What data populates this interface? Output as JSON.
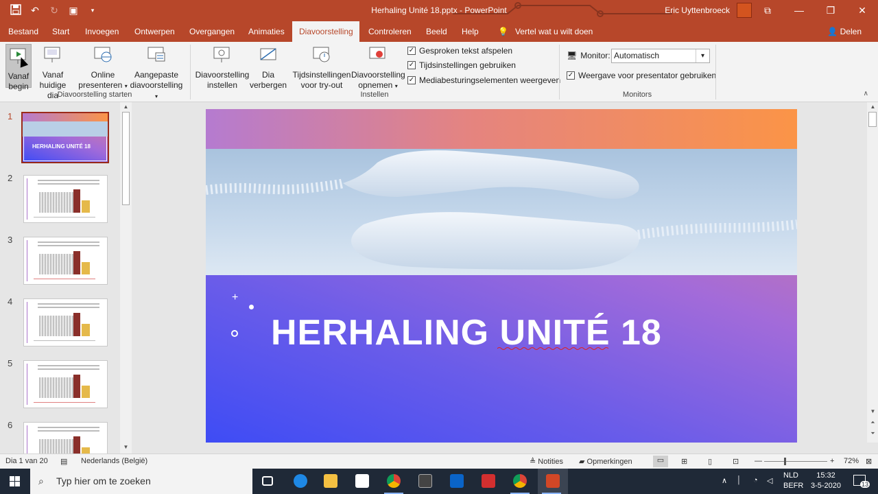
{
  "window": {
    "title": "Herhaling Unité 18.pptx  -  PowerPoint",
    "user": "Eric Uyttenbroeck",
    "icons": [
      "save-icon",
      "undo-icon",
      "redo-icon",
      "start-slideshow-icon",
      "customize-qat-icon"
    ]
  },
  "tabs": [
    "Bestand",
    "Start",
    "Invoegen",
    "Ontwerpen",
    "Overgangen",
    "Animaties",
    "Diavoorstelling",
    "Controleren",
    "Beeld",
    "Help"
  ],
  "active_tab": "Diavoorstelling",
  "tell_me": "Vertel wat u wilt doen",
  "share": "Delen",
  "ribbon": {
    "start_group": {
      "label": "Diavoorstelling starten",
      "from_start": [
        "Vanaf",
        "begin"
      ],
      "from_current": [
        "Vanaf",
        "huidige dia"
      ],
      "online": [
        "Online",
        "presenteren"
      ],
      "custom": [
        "Aangepaste",
        "diavoorstelling"
      ]
    },
    "setup_group": {
      "label": "Instellen",
      "setup": [
        "Diavoorstelling",
        "instellen"
      ],
      "hide": [
        "Dia",
        "verbergen"
      ],
      "rehearse": [
        "Tijdsinstellingen",
        "voor try-out"
      ],
      "record": [
        "Diavoorstelling",
        "opnemen"
      ],
      "checks": [
        "Gesproken tekst afspelen",
        "Tijdsinstellingen gebruiken",
        "Mediabesturingselementen weergeven"
      ]
    },
    "monitors_group": {
      "label": "Monitors",
      "monitor_label": "Monitor:",
      "monitor_value": "Automatisch",
      "presenter_view": "Weergave voor presentator gebruiken"
    }
  },
  "thumbnails": [
    "1",
    "2",
    "3",
    "4",
    "5",
    "6"
  ],
  "thumb1_title": "HERHALING UNITÉ 18",
  "slide": {
    "title": "HERHALING UNITÉ 18"
  },
  "status": {
    "slide_count": "Dia 1 van 20",
    "language": "Nederlands (België)",
    "notes": "Notities",
    "comments": "Opmerkingen",
    "zoom": "72%"
  },
  "taskbar": {
    "search_placeholder": "Typ hier om te zoeken",
    "lang1": "NLD",
    "lang2": "BEFR",
    "time": "15:32",
    "date": "3-5-2020",
    "notif_count": "13"
  }
}
